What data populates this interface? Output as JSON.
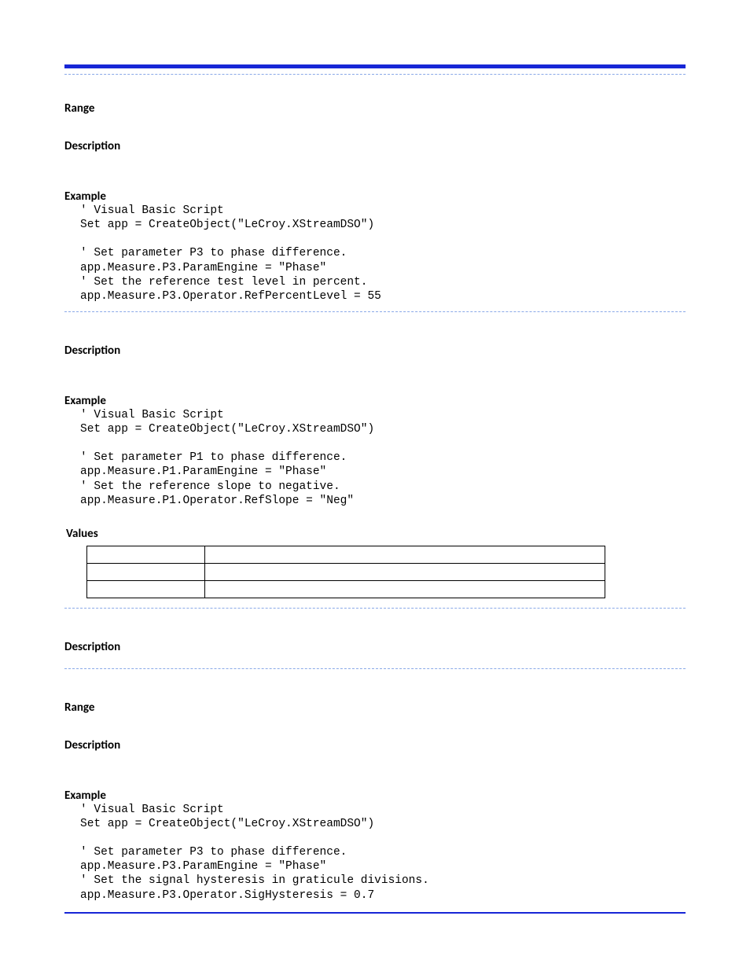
{
  "labels": {
    "range": "Range",
    "description": "Description",
    "example": "Example",
    "values": "Values"
  },
  "code1": "' Visual Basic Script\nSet app = CreateObject(\"LeCroy.XStreamDSO\")\n\n' Set parameter P3 to phase difference.\napp.Measure.P3.ParamEngine = \"Phase\"\n' Set the reference test level in percent.\napp.Measure.P3.Operator.RefPercentLevel = 55",
  "code2": "' Visual Basic Script\nSet app = CreateObject(\"LeCroy.XStreamDSO\")\n\n' Set parameter P1 to phase difference.\napp.Measure.P1.ParamEngine = \"Phase\"\n' Set the reference slope to negative.\napp.Measure.P1.Operator.RefSlope = \"Neg\"",
  "code3": "' Visual Basic Script\nSet app = CreateObject(\"LeCroy.XStreamDSO\")\n\n' Set parameter P3 to phase difference.\napp.Measure.P3.ParamEngine = \"Phase\"\n' Set the signal hysteresis in graticule divisions.\napp.Measure.P3.Operator.SigHysteresis = 0.7",
  "values_rows": [
    [
      "",
      ""
    ],
    [
      "",
      ""
    ],
    [
      "",
      ""
    ]
  ]
}
